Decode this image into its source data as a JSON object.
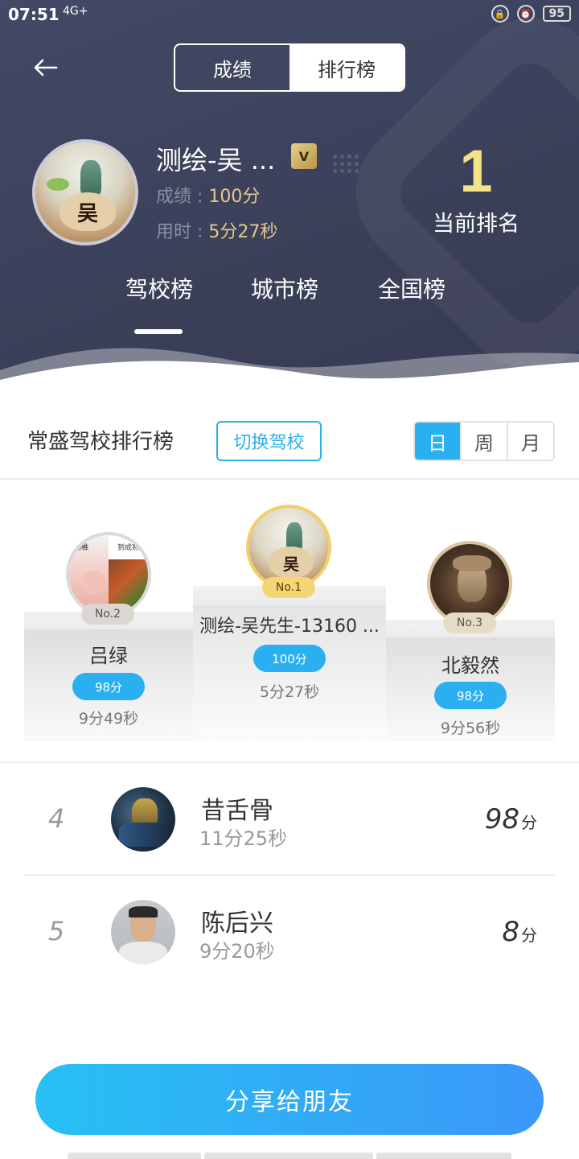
{
  "status_bar": {
    "time": "07:51",
    "signal": "4G+",
    "battery": "95"
  },
  "top_segment": {
    "tabs": [
      "成绩",
      "排行榜"
    ],
    "active_index": 1
  },
  "profile": {
    "name": "测绘-吴 ...",
    "vip_label": "V",
    "score_label": "成绩",
    "score_value": "100分",
    "time_label": "用时",
    "time_value": "5分27秒",
    "avatar_char": "吴",
    "rank": "1",
    "rank_label": "当前排名"
  },
  "board_tabs": {
    "items": [
      "驾校榜",
      "城市榜",
      "全国榜"
    ],
    "active_index": 0
  },
  "section": {
    "title": "常盛驾校排行榜",
    "switch_label": "切换驾校",
    "periods": [
      "日",
      "周",
      "月"
    ],
    "active_period": 0
  },
  "podium": {
    "first": {
      "badge": "No.1",
      "name": "测绘-吴先生-13160 ...",
      "score": "100分",
      "time": "5分27秒",
      "avatar_char": "吴"
    },
    "second": {
      "badge": "No.2",
      "name": "吕绿",
      "score": "98分",
      "time": "9分49秒",
      "caption_left": "幼稚",
      "caption_right": "到成熟"
    },
    "third": {
      "badge": "No.3",
      "name": "北毅然",
      "score": "98分",
      "time": "9分56秒"
    }
  },
  "list": [
    {
      "rank": "4",
      "name": "昔舌骨",
      "time": "11分25秒",
      "score": "98",
      "unit": "分"
    },
    {
      "rank": "5",
      "name": "陈后兴",
      "time": "9分20秒",
      "score": "8",
      "unit": "分"
    }
  ],
  "share_button": "分享给朋友",
  "colors": {
    "header_bg": "#3d425b",
    "accent_blue": "#2ab0f1",
    "rank_yellow": "#f4e287",
    "gold_text": "#e3c98a"
  }
}
